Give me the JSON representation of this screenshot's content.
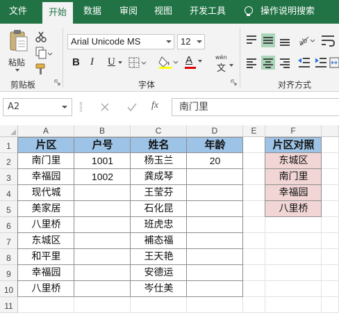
{
  "menu": {
    "tabs": [
      "文件",
      "开始",
      "数据",
      "审阅",
      "视图",
      "开发工具"
    ],
    "active_tab": "开始",
    "tell_me": "操作说明搜索"
  },
  "ribbon": {
    "clipboard": {
      "paste_label": "粘贴",
      "group_label": "剪贴板"
    },
    "font": {
      "font_name": "Arial Unicode MS",
      "font_size": "12",
      "bold": "B",
      "italic": "I",
      "underline": "U",
      "font_color_glyph": "A",
      "phonetic_glyph": "wén",
      "phonetic_char": "文",
      "group_label": "字体"
    },
    "alignment": {
      "group_label": "对齐方式"
    }
  },
  "formula_bar": {
    "name_box": "A2",
    "fx": "fx",
    "content": "南门里"
  },
  "sheet": {
    "columns": [
      "A",
      "B",
      "C",
      "D",
      "E",
      "F"
    ],
    "rows": [
      "1",
      "2",
      "3",
      "4",
      "5",
      "6",
      "7",
      "8",
      "9",
      "10",
      "11"
    ],
    "table_headers": [
      "片区",
      "户号",
      "姓名",
      "年龄"
    ],
    "col_a": [
      "南门里",
      "幸福园",
      "现代城",
      "美家居",
      "八里桥",
      "东城区",
      "和平里",
      "幸福园",
      "八里桥"
    ],
    "col_b": [
      "1001",
      "1002",
      "",
      "",
      "",
      "",
      "",
      "",
      ""
    ],
    "col_c": [
      "杨玉兰",
      "龚成琴",
      "王莹芬",
      "石化昆",
      "班虎忠",
      "補态福",
      "王天艳",
      "安德运",
      "岑仕美"
    ],
    "col_d": [
      "20",
      "",
      "",
      "",
      "",
      "",
      "",
      "",
      ""
    ],
    "lookup_header": "片区对照",
    "lookup_values": [
      "东城区",
      "南门里",
      "幸福园",
      "八里桥"
    ],
    "colors": {
      "header_fill": "#9dc3e6",
      "lookup_fill": "#f2d6d6",
      "ribbon_green": "#217346"
    }
  }
}
